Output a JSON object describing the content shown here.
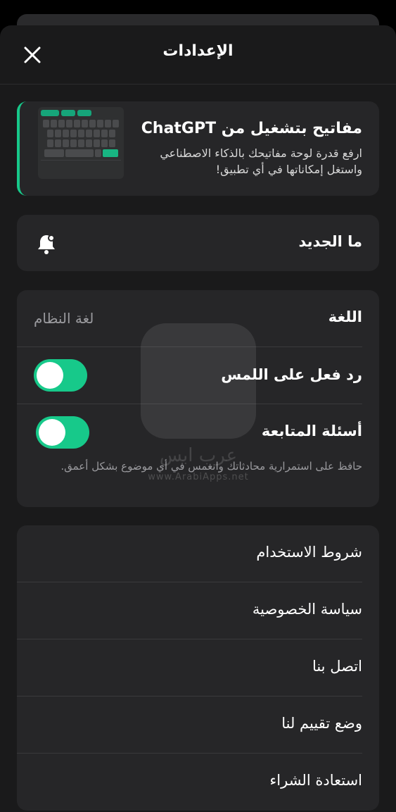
{
  "header": {
    "title": "الإعدادات",
    "close_icon": "close-icon"
  },
  "promo": {
    "title": "مفاتيح بتشغيل من ChatGPT",
    "description": "ارفع قدرة لوحة مفاتيحك بالذكاء الاصطناعي واستغل إمكاناتها في أي تطبيق!",
    "accent_color": "#17c98a",
    "image": "keyboard-preview"
  },
  "whats_new": {
    "label": "ما الجديد",
    "icon": "bell-icon"
  },
  "settings": {
    "language": {
      "label": "اللغة",
      "value": "لغة النظام"
    },
    "haptic": {
      "label": "رد فعل على اللمس",
      "enabled": true
    },
    "followup": {
      "label": "أسئلة المتابعة",
      "enabled": true,
      "hint": "حافظ على استمرارية محادثاتك وانغمس في أي موضوع بشكل أعمق."
    }
  },
  "links": [
    {
      "label": "شروط الاستخدام"
    },
    {
      "label": "سياسة الخصوصية"
    },
    {
      "label": "اتصل بنا"
    },
    {
      "label": "وضع تقييم لنا"
    },
    {
      "label": "استعادة الشراء"
    }
  ],
  "watermark": {
    "text": "عرب ابس",
    "url": "www.ArabiApps.net"
  }
}
